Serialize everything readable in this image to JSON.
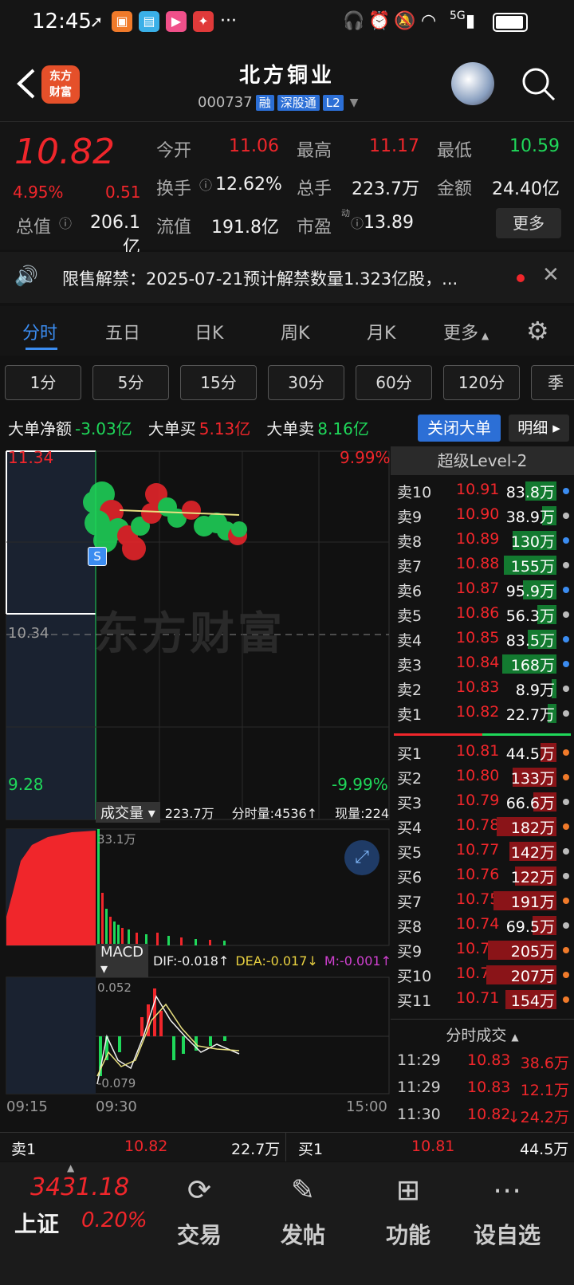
{
  "status_bar": {
    "time": "12:45",
    "signal": "5G",
    "more": "···"
  },
  "header": {
    "logo_text_line1": "东方",
    "logo_text_line2": "财富",
    "stock_name": "北方铜业",
    "stock_code": "000737",
    "tags": [
      "融",
      "深股通",
      "L2"
    ]
  },
  "quote": {
    "price": "10.82",
    "change_pct": "4.95%",
    "change": "0.51",
    "open_label": "今开",
    "open": "11.06",
    "high_label": "最高",
    "high": "11.17",
    "low_label": "最低",
    "low": "10.59",
    "turnover_label": "换手",
    "turnover": "12.62%",
    "volume_label": "总手",
    "volume": "223.7万",
    "amount_label": "金额",
    "amount": "24.40亿",
    "mcap_label": "总值",
    "mcap": "206.1亿",
    "float_label": "流值",
    "float": "191.8亿",
    "pe_label": "市盈",
    "pe_sup": "动",
    "pe": "13.89",
    "more_button": "更多"
  },
  "notice": {
    "text": "限售解禁：2025-07-21预计解禁数量1.323亿股，..."
  },
  "tabs": [
    "分时",
    "五日",
    "日K",
    "周K",
    "月K",
    "更多"
  ],
  "periods": [
    "1分",
    "5分",
    "15分",
    "30分",
    "60分",
    "120分",
    "季"
  ],
  "big_order": {
    "net_label": "大单净额",
    "net": "-3.03亿",
    "buy_label": "大单买",
    "buy": "5.13亿",
    "sell_label": "大单卖",
    "sell": "8.16亿",
    "close_button": "关闭大单",
    "detail_button": "明细"
  },
  "chart": {
    "price_high": "11.34",
    "price_mid": "10.34",
    "price_low": "9.28",
    "pct_high": "9.99%",
    "pct_low": "-9.99%",
    "watermark": "东方财富",
    "s_marker": "S",
    "volume_selector": "成交量",
    "volume_total": "223.7万",
    "minute_volume": "分时量:4536↑",
    "current_volume": "现量:224",
    "volume_axis_max": "33.1万",
    "macd_selector": "MACD",
    "dif": "DIF:-0.018↑",
    "dea": "DEA:-0.017↓",
    "m": "M:-0.001↑",
    "macd_max": "0.052",
    "macd_min": "-0.079",
    "time_start": "09:15",
    "time_open": "09:30",
    "time_end": "15:00"
  },
  "order_book": {
    "title": "超级Level-2",
    "asks": [
      {
        "label": "卖10",
        "price": "10.91",
        "volume": "83.8万",
        "fill": 0.35,
        "dot": "#3b8cf0"
      },
      {
        "label": "卖9",
        "price": "10.90",
        "volume": "38.9万",
        "fill": 0.16,
        "dot": "#bbbbbb"
      },
      {
        "label": "卖8",
        "price": "10.89",
        "volume": "130万",
        "fill": 0.5,
        "dot": "#3b8cf0"
      },
      {
        "label": "卖7",
        "price": "10.88",
        "volume": "155万",
        "fill": 0.6,
        "dot": "#bbbbbb"
      },
      {
        "label": "卖6",
        "price": "10.87",
        "volume": "95.9万",
        "fill": 0.38,
        "dot": "#3b8cf0"
      },
      {
        "label": "卖5",
        "price": "10.86",
        "volume": "56.3万",
        "fill": 0.22,
        "dot": "#bbbbbb"
      },
      {
        "label": "卖4",
        "price": "10.85",
        "volume": "83.5万",
        "fill": 0.33,
        "dot": "#3b8cf0"
      },
      {
        "label": "卖3",
        "price": "10.84",
        "volume": "168万",
        "fill": 0.62,
        "dot": "#3b8cf0"
      },
      {
        "label": "卖2",
        "price": "10.83",
        "volume": "8.9万",
        "fill": 0.05,
        "dot": "#bbbbbb"
      },
      {
        "label": "卖1",
        "price": "10.82",
        "volume": "22.7万",
        "fill": 0.1,
        "dot": "#bbbbbb"
      }
    ],
    "bids": [
      {
        "label": "买1",
        "price": "10.81",
        "volume": "44.5万",
        "fill": 0.18,
        "dot": "#f07a2a"
      },
      {
        "label": "买2",
        "price": "10.80",
        "volume": "133万",
        "fill": 0.5,
        "dot": "#f07a2a"
      },
      {
        "label": "买3",
        "price": "10.79",
        "volume": "66.6万",
        "fill": 0.26,
        "dot": "#bbbbbb"
      },
      {
        "label": "买4",
        "price": "10.78",
        "volume": "182万",
        "fill": 0.68,
        "dot": "#f07a2a"
      },
      {
        "label": "买5",
        "price": "10.77",
        "volume": "142万",
        "fill": 0.54,
        "dot": "#bbbbbb"
      },
      {
        "label": "买6",
        "price": "10.76",
        "volume": "122万",
        "fill": 0.47,
        "dot": "#bbbbbb"
      },
      {
        "label": "买7",
        "price": "10.75",
        "volume": "191万",
        "fill": 0.72,
        "dot": "#f07a2a"
      },
      {
        "label": "买8",
        "price": "10.74",
        "volume": "69.5万",
        "fill": 0.27,
        "dot": "#bbbbbb"
      },
      {
        "label": "买9",
        "price": "10.73",
        "volume": "205万",
        "fill": 0.78,
        "dot": "#f07a2a"
      },
      {
        "label": "买10",
        "price": "10.72",
        "volume": "207万",
        "fill": 0.8,
        "dot": "#f07a2a"
      },
      {
        "label": "买11",
        "price": "10.71",
        "volume": "154万",
        "fill": 0.58,
        "dot": "#f07a2a"
      }
    ],
    "trades_title": "分时成交",
    "trades": [
      {
        "time": "11:29",
        "price": "10.83",
        "volume": "38.6万"
      },
      {
        "time": "11:29",
        "price": "10.83",
        "volume": "12.1万"
      },
      {
        "time": "11:30",
        "price": "10.82",
        "volume": "↓24.2万"
      }
    ]
  },
  "bottom_strip": {
    "sell1_label": "卖1",
    "sell1_price": "10.82",
    "sell1_volume": "22.7万",
    "buy1_label": "买1",
    "buy1_price": "10.81",
    "buy1_volume": "44.5万"
  },
  "bottom_nav": {
    "index_value": "3431.18",
    "index_name": "上证",
    "index_change": "0.20%",
    "items": [
      "交易",
      "发帖",
      "功能",
      "设自选"
    ]
  }
}
